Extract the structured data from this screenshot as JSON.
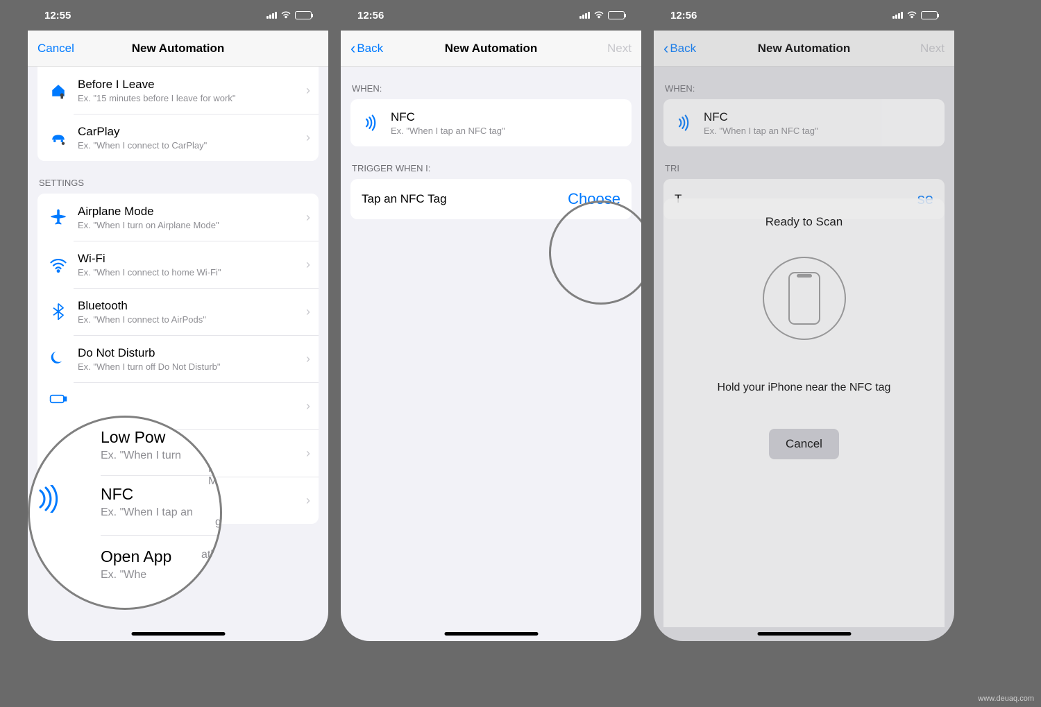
{
  "watermark": "www.deuaq.com",
  "screens": {
    "s1": {
      "status_time": "12:55",
      "nav_left": "Cancel",
      "nav_title": "New Automation",
      "triggers": [
        {
          "icon": "home",
          "title": "Before I Leave",
          "sub": "Ex. \"15 minutes before I leave for work\""
        },
        {
          "icon": "car",
          "title": "CarPlay",
          "sub": "Ex. \"When I connect to CarPlay\""
        }
      ],
      "settings_header": "SETTINGS",
      "settings": [
        {
          "icon": "airplane",
          "title": "Airplane Mode",
          "sub": "Ex. \"When I turn on Airplane Mode\""
        },
        {
          "icon": "wifi",
          "title": "Wi-Fi",
          "sub": "Ex. \"When I connect to home Wi-Fi\""
        },
        {
          "icon": "bluetooth",
          "title": "Bluetooth",
          "sub": "Ex. \"When I connect to AirPods\""
        },
        {
          "icon": "moon",
          "title": "Do Not Disturb",
          "sub": "Ex. \"When I turn off Do Not Disturb\""
        },
        {
          "icon": "battery",
          "title": "Low Power Mode",
          "sub": "Ex. \"When I turn on Low Power Mode\""
        },
        {
          "icon": "nfc",
          "title": "NFC",
          "sub": "Ex. \"When I tap an NFC tag\""
        }
      ],
      "magnify": {
        "row1_title": "Low Pow",
        "row1_sub": "Ex. \"When I turn",
        "row1_sub2": "Power Mode\"",
        "row2_title": "NFC",
        "row2_sub": "Ex. \"When I tap an",
        "row2_sub2": "g\"",
        "row3_title": "Open App",
        "row3_sub": "Ex. \"Whe",
        "row3_sub2": "ather\""
      }
    },
    "s2": {
      "status_time": "12:56",
      "nav_left": "Back",
      "nav_title": "New Automation",
      "nav_right": "Next",
      "when_header": "WHEN:",
      "when_title": "NFC",
      "when_sub": "Ex. \"When I tap an NFC tag\"",
      "trigger_header": "TRIGGER WHEN I:",
      "trigger_label": "Tap an NFC Tag",
      "choose": "Choose"
    },
    "s3": {
      "status_time": "12:56",
      "nav_left": "Back",
      "nav_title": "New Automation",
      "nav_right": "Next",
      "when_header": "WHEN:",
      "when_title": "NFC",
      "when_sub": "Ex. \"When I tap an NFC tag\"",
      "trigger_header": "TRI",
      "trigger_label": "T",
      "choose_partial": "se",
      "sheet_title": "Ready to Scan",
      "sheet_text": "Hold your iPhone near the NFC tag",
      "sheet_cancel": "Cancel"
    }
  }
}
